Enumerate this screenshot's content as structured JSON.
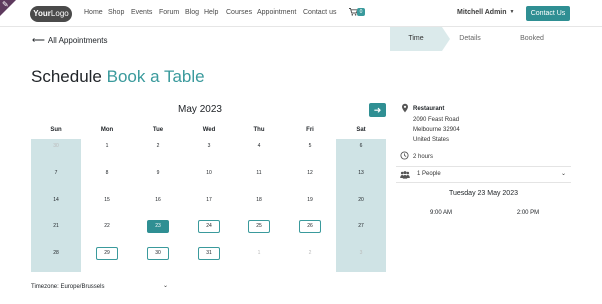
{
  "nav": {
    "logo": {
      "main": "Your",
      "accent": "Logo"
    },
    "links": [
      "Home",
      "Shop",
      "Events",
      "Forum",
      "Blog",
      "Help",
      "Courses",
      "Appointment",
      "Contact us"
    ],
    "cart_count": "0",
    "user": "Mitchell Admin",
    "contact_button": "Contact Us"
  },
  "back_link": "All Appointments",
  "steps": [
    "Time",
    "Details",
    "Booked"
  ],
  "title": {
    "prefix": "Schedule",
    "accent": "Book a Table"
  },
  "calendar": {
    "month": "May 2023",
    "weekdays": [
      "Sun",
      "Mon",
      "Tue",
      "Wed",
      "Thu",
      "Fri",
      "Sat"
    ],
    "weeks": [
      [
        "30",
        "1",
        "2",
        "3",
        "4",
        "5",
        "6"
      ],
      [
        "7",
        "8",
        "9",
        "10",
        "11",
        "12",
        "13"
      ],
      [
        "14",
        "15",
        "16",
        "17",
        "18",
        "19",
        "20"
      ],
      [
        "21",
        "22",
        "23",
        "24",
        "25",
        "26",
        "27"
      ],
      [
        "28",
        "29",
        "30",
        "31",
        "1",
        "2",
        "3"
      ]
    ],
    "selected": "23",
    "available": [
      "24",
      "25",
      "26",
      "29",
      "30",
      "31"
    ]
  },
  "timezone": "Timezone: Europe/Brussels",
  "info": {
    "venue": "Restaurant",
    "address_lines": [
      "2090 Feast Road",
      "Melbourne 32904",
      "United States"
    ],
    "duration": "2 hours",
    "people": "1 People",
    "selected_date": "Tuesday 23 May 2023",
    "slots": [
      "9:00 AM",
      "2:00 PM"
    ]
  },
  "colors": {
    "accent": "#3a9a9c",
    "accent_dark": "#2f8f93",
    "weekend_bg": "#cfe3e5",
    "step_bg": "#dbeaeb"
  }
}
